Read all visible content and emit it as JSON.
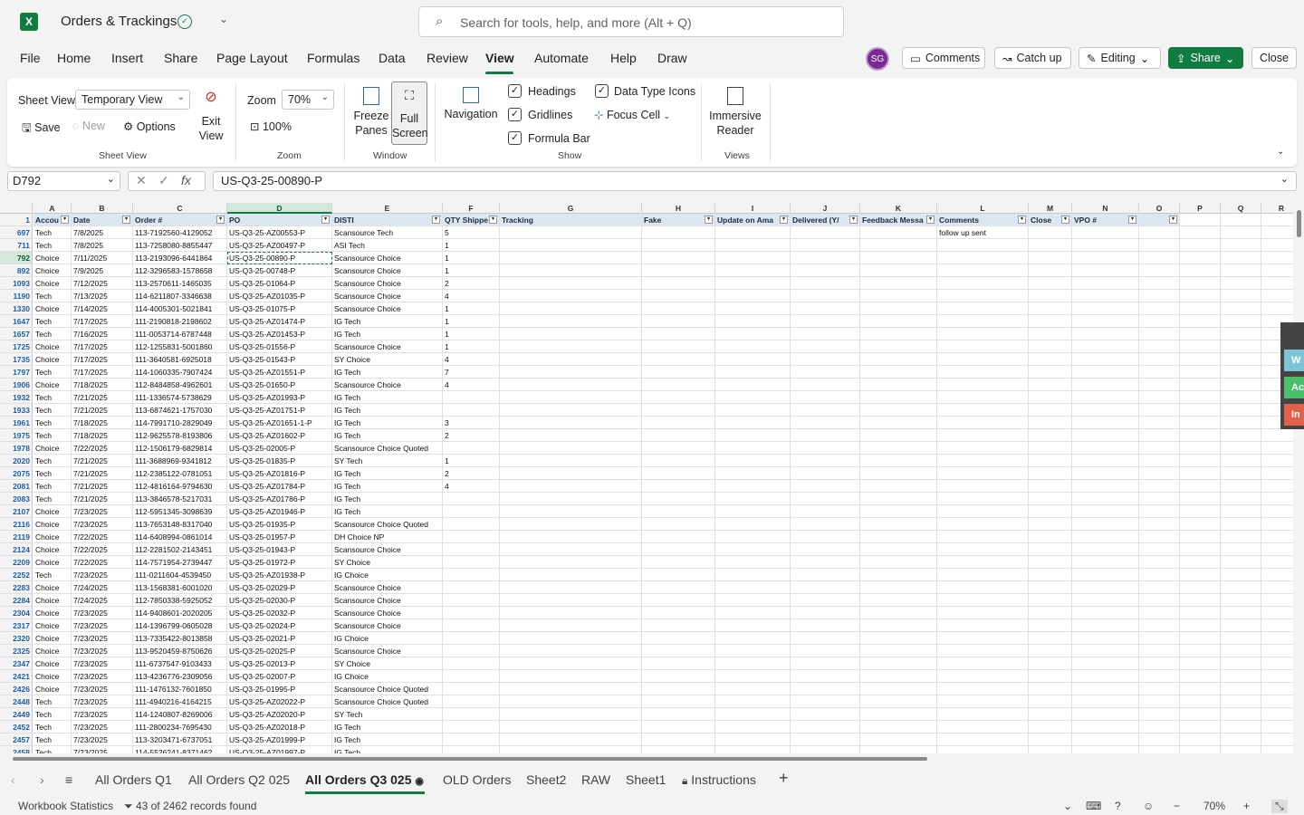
{
  "app": {
    "title": "Orders & Trackings",
    "logo": "X"
  },
  "search": {
    "placeholder": "Search for tools, help, and more (Alt + Q)"
  },
  "menu": {
    "items": [
      "File",
      "Home",
      "Insert",
      "Share",
      "Page Layout",
      "Formulas",
      "Data",
      "Review",
      "View",
      "Automate",
      "Help",
      "Draw"
    ],
    "active": "View"
  },
  "user": {
    "initials": "SG"
  },
  "top_buttons": {
    "comments": "Comments",
    "catchup": "Catch up",
    "editing": "Editing",
    "share": "Share",
    "close": "Close"
  },
  "ribbon": {
    "sheet_view_label": "Sheet View",
    "sheet_view_value": "Temporary View",
    "save": "Save",
    "new": "New",
    "options": "Options",
    "exit_view": "Exit View",
    "group_sheet_view": "Sheet View",
    "zoom_label": "Zoom",
    "zoom_value": "70%",
    "zoom_100": "100%",
    "group_zoom": "Zoom",
    "freeze_panes": "Freeze Panes",
    "full_screen": "Full Screen",
    "group_window": "Window",
    "navigation": "Navigation",
    "headings": "Headings",
    "gridlines": "Gridlines",
    "formula_bar": "Formula Bar",
    "data_type_icons": "Data Type Icons",
    "focus_cell": "Focus Cell",
    "group_show": "Show",
    "immersive_reader": "Immersive Reader",
    "group_views": "Views"
  },
  "formula": {
    "name_box": "D792",
    "value": "US-Q3-25-00890-P"
  },
  "columns": [
    "A",
    "B",
    "C",
    "D",
    "E",
    "F",
    "G",
    "H",
    "I",
    "J",
    "K",
    "L",
    "M",
    "N",
    "O",
    "P",
    "Q",
    "R"
  ],
  "header_row": {
    "num": "1",
    "cells": [
      "Accou",
      "Date",
      "Order #",
      "PO",
      "DISTI",
      "QTY Shippe",
      "Tracking",
      "Fake",
      "Update on Ama",
      "Delivered (Y/",
      "Feedback Messa",
      "Comments",
      "Close",
      "VPO #",
      "",
      "",
      "",
      ""
    ]
  },
  "rows": [
    [
      "697",
      "Tech",
      "7/8/2025",
      "113-7192560-4129052",
      "US-Q3-25-AZ00553-P",
      "Scansource Tech",
      "5",
      "follow up sent"
    ],
    [
      "711",
      "Tech",
      "7/8/2025",
      "113-7258080-8855447",
      "US-Q3-25-AZ00497-P",
      "ASI Tech",
      "1",
      ""
    ],
    [
      "792",
      "Choice",
      "7/11/2025",
      "113-2193096-6441864",
      "US-Q3-25-00890-P",
      "Scansource Choice",
      "1",
      ""
    ],
    [
      "892",
      "Choice",
      "7/9/2025",
      "112-3296583-1578658",
      "US-Q3-25-00748-P",
      "Scansource Choice",
      "1",
      ""
    ],
    [
      "1093",
      "Choice",
      "7/12/2025",
      "113-2570611-1465035",
      "US-Q3-25-01064-P",
      "Scansource Choice",
      "2",
      ""
    ],
    [
      "1190",
      "Tech",
      "7/13/2025",
      "114-6211807-3346638",
      "US-Q3-25-AZ01035-P",
      "Scansource Choice",
      "4",
      ""
    ],
    [
      "1330",
      "Choice",
      "7/14/2025",
      "114-4005301-5021841",
      "US-Q3-25-01075-P",
      "Scansource Choice",
      "1",
      ""
    ],
    [
      "1647",
      "Tech",
      "7/17/2025",
      "111-2190818-2198602",
      "US-Q3-25-AZ01474-P",
      "IG Tech",
      "1",
      ""
    ],
    [
      "1657",
      "Tech",
      "7/16/2025",
      "111-0053714-6787448",
      "US-Q3-25-AZ01453-P",
      "IG Tech",
      "1",
      ""
    ],
    [
      "1725",
      "Choice",
      "7/17/2025",
      "112-1255831-5001860",
      "US-Q3-25-01556-P",
      "Scansource Choice",
      "1",
      ""
    ],
    [
      "1735",
      "Choice",
      "7/17/2025",
      "111-3640581-6925018",
      "US-Q3-25-01543-P",
      "SY Choice",
      "4",
      ""
    ],
    [
      "1797",
      "Tech",
      "7/17/2025",
      "114-1060335-7907424",
      "US-Q3-25-AZ01551-P",
      "IG Tech",
      "7",
      ""
    ],
    [
      "1906",
      "Choice",
      "7/18/2025",
      "112-8484858-4962601",
      "US-Q3-25-01650-P",
      "Scansource Choice",
      "4",
      ""
    ],
    [
      "1932",
      "Tech",
      "7/21/2025",
      "111-1336574-5738629",
      "US-Q3-25-AZ01993-P",
      "IG Tech",
      "",
      ""
    ],
    [
      "1933",
      "Tech",
      "7/21/2025",
      "113-6874621-1757030",
      "US-Q3-25-AZ01751-P",
      "IG Tech",
      "",
      ""
    ],
    [
      "1961",
      "Tech",
      "7/18/2025",
      "114-7991710-2829049",
      "US-Q3-25-AZ01651-1-P",
      "IG Tech",
      "3",
      ""
    ],
    [
      "1975",
      "Tech",
      "7/18/2025",
      "112-9625578-8193806",
      "US-Q3-25-AZ01602-P",
      "IG Tech",
      "2",
      ""
    ],
    [
      "1978",
      "Choice",
      "7/22/2025",
      "112-1506179-6829814",
      "US-Q3-25-02005-P",
      "Scansource Choice Quoted",
      "",
      ""
    ],
    [
      "2020",
      "Tech",
      "7/21/2025",
      "111-3688969-9341812",
      "US-Q3-25-01835-P",
      "SY Tech",
      "1",
      ""
    ],
    [
      "2075",
      "Tech",
      "7/21/2025",
      "112-2385122-0781051",
      "US-Q3-25-AZ01816-P",
      "IG Tech",
      "2",
      ""
    ],
    [
      "2081",
      "Tech",
      "7/21/2025",
      "112-4816164-9794630",
      "US-Q3-25-AZ01784-P",
      "IG Tech",
      "4",
      ""
    ],
    [
      "2083",
      "Tech",
      "7/21/2025",
      "113-3846578-5217031",
      "US-Q3-25-AZ01786-P",
      "IG Tech",
      "",
      ""
    ],
    [
      "2107",
      "Choice",
      "7/23/2025",
      "112-5951345-3098639",
      "US-Q3-25-AZ01946-P",
      "IG Tech",
      "",
      ""
    ],
    [
      "2116",
      "Choice",
      "7/23/2025",
      "113-7653148-8317040",
      "US-Q3-25-01935-P",
      "Scansource Choice Quoted",
      "",
      ""
    ],
    [
      "2119",
      "Choice",
      "7/22/2025",
      "114-6408994-0861014",
      "US-Q3-25-01957-P",
      "DH Choice NP",
      "",
      ""
    ],
    [
      "2124",
      "Choice",
      "7/22/2025",
      "112-2281502-2143451",
      "US-Q3-25-01943-P",
      "Scansource Choice",
      "",
      ""
    ],
    [
      "2209",
      "Choice",
      "7/22/2025",
      "114-7571954-2739447",
      "US-Q3-25-01972-P",
      "SY Choice",
      "",
      ""
    ],
    [
      "2252",
      "Tech",
      "7/23/2025",
      "111-0211604-4539450",
      "US-Q3-25-AZ01938-P",
      "IG Choice",
      "",
      ""
    ],
    [
      "2283",
      "Choice",
      "7/24/2025",
      "113-1568381-6001020",
      "US-Q3-25-02029-P",
      "Scansource Choice",
      "",
      ""
    ],
    [
      "2284",
      "Choice",
      "7/24/2025",
      "112-7850338-5925052",
      "US-Q3-25-02030-P",
      "Scansource Choice",
      "",
      ""
    ],
    [
      "2304",
      "Choice",
      "7/23/2025",
      "114-9408601-2020205",
      "US-Q3-25-02032-P",
      "Scansource Choice",
      "",
      ""
    ],
    [
      "2317",
      "Choice",
      "7/23/2025",
      "114-1396799-0605028",
      "US-Q3-25-02024-P",
      "Scansource Choice",
      "",
      ""
    ],
    [
      "2320",
      "Choice",
      "7/23/2025",
      "113-7335422-8013858",
      "US-Q3-25-02021-P",
      "IG Choice",
      "",
      ""
    ],
    [
      "2325",
      "Choice",
      "7/23/2025",
      "113-9520459-8750626",
      "US-Q3-25-02025-P",
      "Scansource Choice",
      "",
      ""
    ],
    [
      "2347",
      "Choice",
      "7/23/2025",
      "111-6737547-9103433",
      "US-Q3-25-02013-P",
      "SY Choice",
      "",
      ""
    ],
    [
      "2421",
      "Choice",
      "7/23/2025",
      "113-4236776-2309056",
      "US-Q3-25-02007-P",
      "IG Choice",
      "",
      ""
    ],
    [
      "2426",
      "Choice",
      "7/23/2025",
      "111-1476132-7601850",
      "US-Q3-25-01995-P",
      "Scansource Choice Quoted",
      "",
      ""
    ],
    [
      "2448",
      "Tech",
      "7/23/2025",
      "111-4940216-4164215",
      "US-Q3-25-AZ02022-P",
      "Scansource Choice Quoted",
      "",
      ""
    ],
    [
      "2449",
      "Tech",
      "7/23/2025",
      "114-1240807-8269006",
      "US-Q3-25-AZ02020-P",
      "SY Tech",
      "",
      ""
    ],
    [
      "2452",
      "Tech",
      "7/23/2025",
      "111-2800234-7695430",
      "US-Q3-25-AZ02018-P",
      "IG Tech",
      "",
      ""
    ],
    [
      "2457",
      "Tech",
      "7/23/2025",
      "113-3203471-6737051",
      "US-Q3-25-AZ01999-P",
      "IG Tech",
      "",
      ""
    ],
    [
      "2458",
      "Tech",
      "7/23/2025",
      "114-5526241-8371462",
      "US-Q3-25-AZ01997-P",
      "IG Tech",
      "",
      ""
    ]
  ],
  "side_tabs": [
    "W",
    "Ac",
    "In"
  ],
  "sheets": [
    "All Orders Q1",
    "All Orders Q2 025",
    "All Orders Q3 025",
    "OLD Orders",
    "Sheet2",
    "RAW",
    "Sheet1",
    "Instructions"
  ],
  "active_sheet": "All Orders Q3 025",
  "status": {
    "workbook_stats": "Workbook Statistics",
    "records": "43 of 2462 records found",
    "zoom": "70%"
  },
  "colors": {
    "accent": "#107c41",
    "header_fill": "#dbe7f3",
    "row_num_text": "#1e5fa8"
  }
}
